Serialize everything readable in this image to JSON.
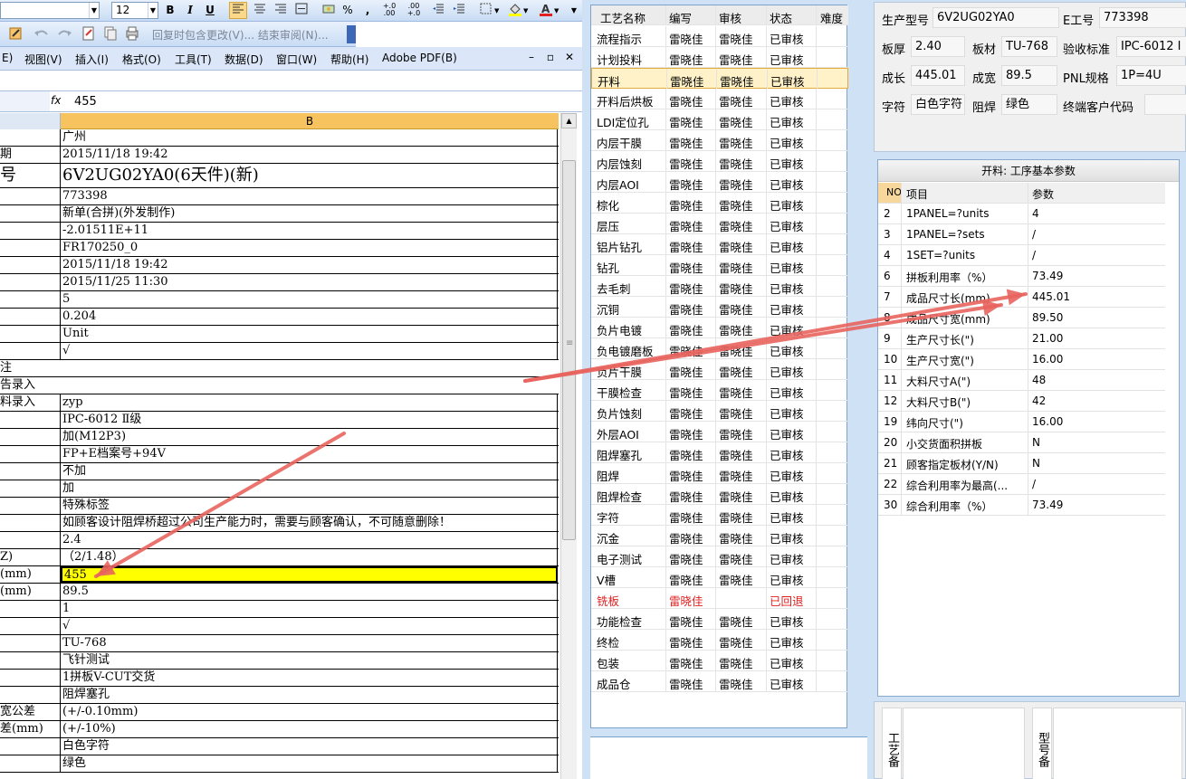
{
  "excel": {
    "toolbar": {
      "font_size": "12",
      "bold": "B",
      "italic": "I",
      "underline": "U",
      "percent": "%",
      "comma": ",",
      "inc_decimal": "+.0 .00",
      "dec_decimal": ".00 +.0",
      "review_text": "回复时包含更改(V)...  结束审阅(N)..."
    },
    "menu": {
      "edit": "E)",
      "view": "视图(V)",
      "insert": "插入(I)",
      "format": "格式(O)",
      "tools": "工具(T)",
      "data": "数据(D)",
      "window": "窗口(W)",
      "help": "帮助(H)",
      "adobe": "Adobe PDF(B)"
    },
    "formula_bar": {
      "fx": "fx",
      "value": "455"
    },
    "column_header": "B",
    "rows": [
      {
        "a": "",
        "b": "广州"
      },
      {
        "a": "期",
        "b": "2015/11/18 19:42"
      },
      {
        "a": "号",
        "b": "6V2UG02YA0(6天件)(新)",
        "big": true
      },
      {
        "a": "",
        "b": "773398"
      },
      {
        "a": "",
        "b": "新单(合拼)(外发制作)"
      },
      {
        "a": "",
        "b": "-2.01511E+11"
      },
      {
        "a": "",
        "b": "FR170250_0"
      },
      {
        "a": "",
        "b": "2015/11/18 19:42"
      },
      {
        "a": "",
        "b": "2015/11/25 11:30"
      },
      {
        "a": "",
        "b": "5"
      },
      {
        "a": "",
        "b": "0.204"
      },
      {
        "a": "",
        "b": "Unit"
      },
      {
        "a": "",
        "b": "√"
      },
      {
        "a": "注",
        "b": "",
        "full": true
      },
      {
        "a": "告录入",
        "b": "",
        "full": true
      },
      {
        "a": "料录入",
        "b": "zyp"
      },
      {
        "a": "",
        "b": "IPC-6012 Ⅱ级"
      },
      {
        "a": "",
        "b": "加(M12P3)"
      },
      {
        "a": "",
        "b": "FP+E档案号+94V"
      },
      {
        "a": "",
        "b": "不加"
      },
      {
        "a": "",
        "b": "加"
      },
      {
        "a": "",
        "b": "特殊标签"
      },
      {
        "a": "",
        "b": "如顾客设计阻焊桥超过公司生产能力时，需要与顾客确认，不可随意删除！"
      },
      {
        "a": "",
        "b": "2.4"
      },
      {
        "a": "Z)",
        "b": "（2/1.48）"
      },
      {
        "a": "(mm)",
        "b": "455",
        "sel": true
      },
      {
        "a": "(mm)",
        "b": "89.5"
      },
      {
        "a": "",
        "b": "1"
      },
      {
        "a": "",
        "b": "√"
      },
      {
        "a": "",
        "b": "TU-768"
      },
      {
        "a": "",
        "b": "飞针测试"
      },
      {
        "a": "",
        "b": "1拼板V-CUT交货"
      },
      {
        "a": "",
        "b": "阻焊塞孔"
      },
      {
        "a": "宽公差",
        "b": "(+/-0.10mm)"
      },
      {
        "a": "差(mm)",
        "b": "(+/-10%)"
      },
      {
        "a": "",
        "b": "白色字符"
      },
      {
        "a": "",
        "b": "绿色"
      }
    ]
  },
  "process_list": {
    "headers": [
      "工艺名称",
      "编写",
      "审核",
      "状态",
      "难度"
    ],
    "rows": [
      [
        "流程指示",
        "雷晓佳",
        "雷晓佳",
        "已审核"
      ],
      [
        "计划投料",
        "雷晓佳",
        "雷晓佳",
        "已审核"
      ],
      [
        "开料",
        "雷晓佳",
        "雷晓佳",
        "已审核"
      ],
      [
        "开料后烘板",
        "雷晓佳",
        "雷晓佳",
        "已审核"
      ],
      [
        "LDI定位孔",
        "雷晓佳",
        "雷晓佳",
        "已审核"
      ],
      [
        "内层干膜",
        "雷晓佳",
        "雷晓佳",
        "已审核"
      ],
      [
        "内层蚀刻",
        "雷晓佳",
        "雷晓佳",
        "已审核"
      ],
      [
        "内层AOI",
        "雷晓佳",
        "雷晓佳",
        "已审核"
      ],
      [
        "棕化",
        "雷晓佳",
        "雷晓佳",
        "已审核"
      ],
      [
        "层压",
        "雷晓佳",
        "雷晓佳",
        "已审核"
      ],
      [
        "铝片钻孔",
        "雷晓佳",
        "雷晓佳",
        "已审核"
      ],
      [
        "钻孔",
        "雷晓佳",
        "雷晓佳",
        "已审核"
      ],
      [
        "去毛刺",
        "雷晓佳",
        "雷晓佳",
        "已审核"
      ],
      [
        "沉铜",
        "雷晓佳",
        "雷晓佳",
        "已审核"
      ],
      [
        "负片电镀",
        "雷晓佳",
        "雷晓佳",
        "已审核"
      ],
      [
        "负电镀磨板",
        "雷晓佳",
        "雷晓佳",
        "已审核"
      ],
      [
        "负片干膜",
        "雷晓佳",
        "雷晓佳",
        "已审核"
      ],
      [
        "干膜检查",
        "雷晓佳",
        "雷晓佳",
        "已审核"
      ],
      [
        "负片蚀刻",
        "雷晓佳",
        "雷晓佳",
        "已审核"
      ],
      [
        "外层AOI",
        "雷晓佳",
        "雷晓佳",
        "已审核"
      ],
      [
        "阻焊塞孔",
        "雷晓佳",
        "雷晓佳",
        "已审核"
      ],
      [
        "阻焊",
        "雷晓佳",
        "雷晓佳",
        "已审核"
      ],
      [
        "阻焊检查",
        "雷晓佳",
        "雷晓佳",
        "已审核"
      ],
      [
        "字符",
        "雷晓佳",
        "雷晓佳",
        "已审核"
      ],
      [
        "沉金",
        "雷晓佳",
        "雷晓佳",
        "已审核"
      ],
      [
        "电子测试",
        "雷晓佳",
        "雷晓佳",
        "已审核"
      ],
      [
        "V槽",
        "雷晓佳",
        "雷晓佳",
        "已审核"
      ],
      [
        "铣板",
        "雷晓佳",
        "",
        "已回退"
      ],
      [
        "功能检查",
        "雷晓佳",
        "雷晓佳",
        "已审核"
      ],
      [
        "终检",
        "雷晓佳",
        "雷晓佳",
        "已审核"
      ],
      [
        "包装",
        "雷晓佳",
        "雷晓佳",
        "已审核"
      ],
      [
        "成品仓",
        "雷晓佳",
        "雷晓佳",
        "已审核"
      ]
    ],
    "highlighted": "开料",
    "returned": "铣板",
    "colors": {
      "returned_text": "#e02020",
      "highlight_bg": "#fff2c9"
    }
  },
  "info": {
    "model_label": "生产型号",
    "model_value": "6V2UG02YA0",
    "eno_label": "E工号",
    "eno_value": "773398",
    "thickness_label": "板厚",
    "thickness_value": "2.40",
    "material_label": "板材",
    "material_value": "TU-768",
    "standard_label": "验收标准",
    "standard_value": "IPC-6012 I",
    "length_label": "成长",
    "length_value": "445.01",
    "width_label": "成宽",
    "width_value": "89.5",
    "pnl_label": "PNL规格",
    "pnl_value": "1P=4U",
    "char_label": "字符",
    "char_value": "白色字符",
    "mask_label": "阻焊",
    "mask_value": "绿色",
    "customer_label": "终端客户代码",
    "customer_value": ""
  },
  "params": {
    "title": "开料: 工序基本参数",
    "headers": [
      "NO",
      "项目",
      "参数"
    ],
    "rows": [
      [
        "2",
        "1PANEL=?units",
        "4"
      ],
      [
        "3",
        "1PANEL=?sets",
        "/"
      ],
      [
        "4",
        "1SET=?units",
        "/"
      ],
      [
        "6",
        "拼板利用率（%）",
        "73.49"
      ],
      [
        "7",
        "成品尺寸长(mm)",
        "445.01"
      ],
      [
        "8",
        "成品尺寸宽(mm)",
        "89.50"
      ],
      [
        "9",
        "生产尺寸长(\")",
        "21.00"
      ],
      [
        "10",
        "生产尺寸宽(\")",
        "16.00"
      ],
      [
        "11",
        "大料尺寸A(\")",
        "48"
      ],
      [
        "12",
        "大料尺寸B(\")",
        "42"
      ],
      [
        "19",
        "纬向尺寸(\")",
        "16.00"
      ],
      [
        "20",
        "小交货面积拼板",
        "N"
      ],
      [
        "21",
        "顾客指定板材(Y/N)",
        "N"
      ],
      [
        "22",
        "综合利用率为最高(...",
        "/"
      ],
      [
        "30",
        "综合利用率（%）",
        "73.49"
      ]
    ]
  },
  "bottom": {
    "process_note_label": "工艺备",
    "model_note_label": "型号备"
  },
  "annotation_color": "#e8645f"
}
